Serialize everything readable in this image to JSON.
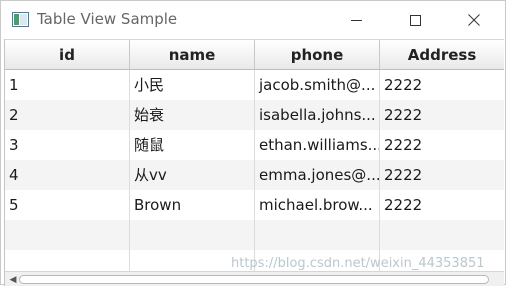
{
  "window": {
    "title": "Table View Sample",
    "controls": {
      "minimize": "minimize",
      "maximize": "maximize",
      "close": "close"
    }
  },
  "table": {
    "columns": [
      "id",
      "name",
      "phone",
      "Address"
    ],
    "rows": [
      [
        "1",
        "小民",
        "jacob.smith@...",
        "2222"
      ],
      [
        "2",
        "始衰",
        "isabella.johns...",
        "2222"
      ],
      [
        "3",
        "随鼠",
        "ethan.williams...",
        "2222"
      ],
      [
        "4",
        "从vv",
        "emma.jones@...",
        "2222"
      ],
      [
        "5",
        "Brown",
        "michael.brow...",
        "2222"
      ]
    ]
  },
  "watermark": "https://blog.csdn.net/weixin_44353851",
  "icons": {
    "app": "table-app-icon",
    "close": "close-icon",
    "maximize": "maximize-icon",
    "minimize": "minimize-icon",
    "scroll_left": "chevron-left-icon"
  }
}
